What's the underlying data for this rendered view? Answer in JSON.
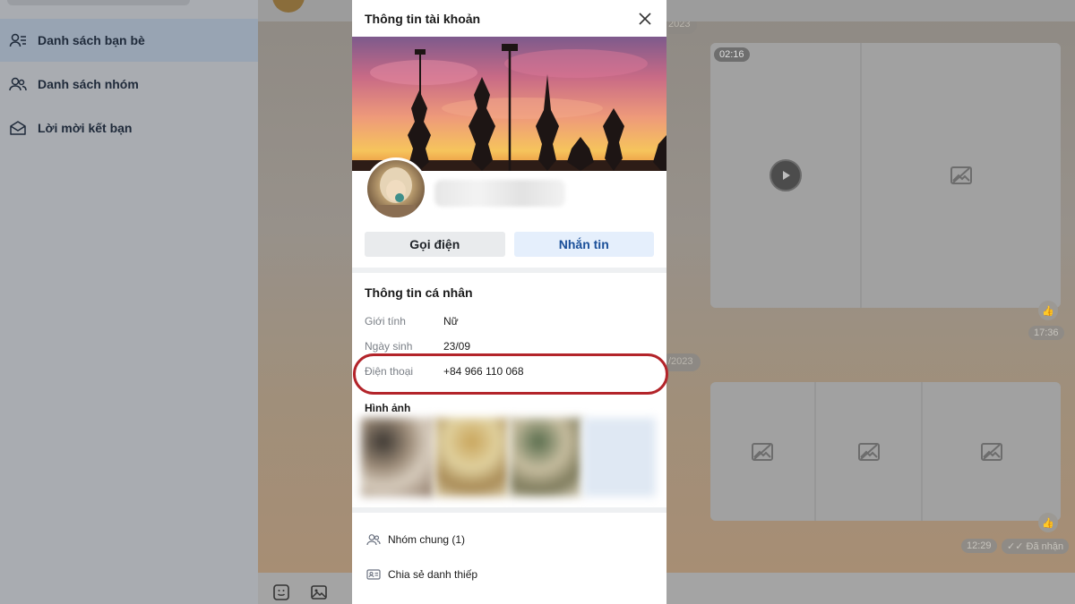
{
  "sidebar": {
    "items": [
      {
        "label": "Danh sách bạn bè",
        "icon": "user-list-icon"
      },
      {
        "label": "Danh sách nhóm",
        "icon": "group-icon"
      },
      {
        "label": "Lời mời kết bạn",
        "icon": "envelope-icon"
      }
    ]
  },
  "chat": {
    "date_pill_1": "2023",
    "date_pill_2": "/2023",
    "video_duration": "02:16",
    "time_1": "17:36",
    "time_2": "12:29",
    "status": "Đã nhận"
  },
  "modal": {
    "title": "Thông tin tài khoản",
    "call_label": "Gọi điện",
    "message_label": "Nhắn tin",
    "personal_section": "Thông tin cá nhân",
    "gender_label": "Giới tính",
    "gender_value": "Nữ",
    "birthday_label": "Ngày sinh",
    "birthday_value": "23/09",
    "phone_label": "Điện thoại",
    "phone_value": "+84 966 110 068",
    "photos_label": "Hình ảnh",
    "common_groups": "Nhóm chung (1)",
    "share_card": "Chia sẻ danh thiếp"
  },
  "colors": {
    "highlight": "#b3242a",
    "message_button_text": "#1a4f99",
    "message_button_bg": "#e5effc"
  }
}
